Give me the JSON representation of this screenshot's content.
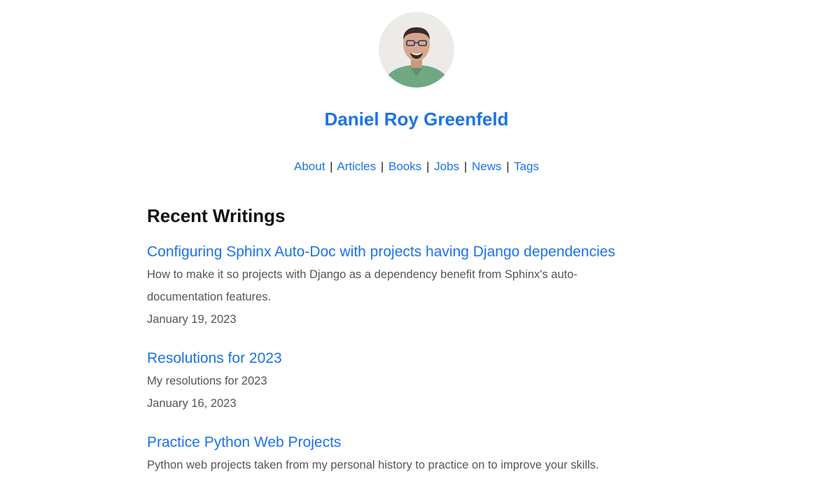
{
  "header": {
    "avatar_icon": "author-portrait-avatar",
    "site_title": "Daniel Roy Greenfeld"
  },
  "nav": {
    "items": [
      {
        "label": "About"
      },
      {
        "label": "Articles"
      },
      {
        "label": "Books"
      },
      {
        "label": "Jobs"
      },
      {
        "label": "News"
      },
      {
        "label": "Tags"
      }
    ],
    "separator": "|"
  },
  "main": {
    "section_title": "Recent Writings",
    "posts": [
      {
        "title": "Configuring Sphinx Auto-Doc with projects having Django dependencies",
        "description": "How to make it so projects with Django as a dependency benefit from Sphinx's auto-documentation features.",
        "date": "January 19, 2023"
      },
      {
        "title": "Resolutions for 2023",
        "description": "My resolutions for 2023",
        "date": "January 16, 2023"
      },
      {
        "title": "Practice Python Web Projects",
        "description": "Python web projects taken from my personal history to practice on to improve your skills.",
        "date": ""
      }
    ]
  },
  "colors": {
    "link": "#1b73e8",
    "text_muted": "#555555",
    "heading": "#111111",
    "background": "#ffffff"
  }
}
